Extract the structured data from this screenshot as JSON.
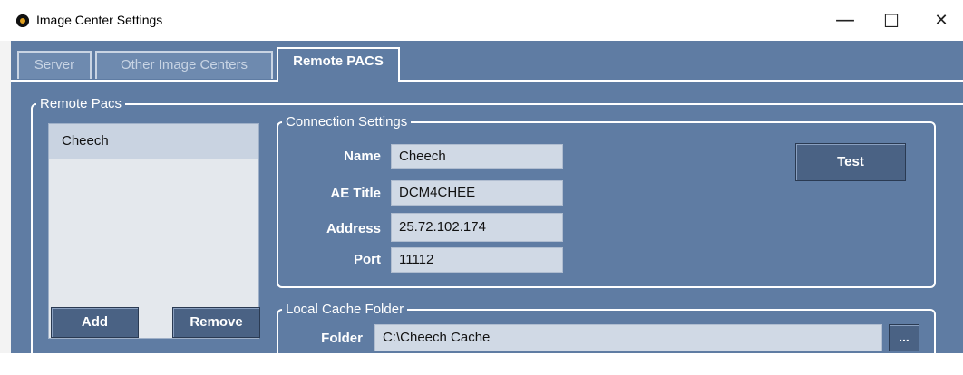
{
  "window": {
    "title": "Image Center Settings",
    "controls": {
      "minimize": "—",
      "maximize": "☐",
      "close": "✕"
    }
  },
  "tabs": [
    {
      "label": "Server",
      "active": false
    },
    {
      "label": "Other Image Centers",
      "active": false
    },
    {
      "label": "Remote PACS",
      "active": true
    }
  ],
  "remote_pacs": {
    "group_label": "Remote Pacs",
    "list": [
      "Cheech"
    ],
    "add_label": "Add",
    "remove_label": "Remove"
  },
  "connection": {
    "group_label": "Connection Settings",
    "name_label": "Name",
    "name_value": "Cheech",
    "ae_title_label": "AE Title",
    "ae_title_value": "DCM4CHEE",
    "address_label": "Address",
    "address_value": "25.72.102.174",
    "port_label": "Port",
    "port_value": "11112",
    "test_label": "Test"
  },
  "cache": {
    "group_label": "Local Cache Folder",
    "folder_label": "Folder",
    "folder_value": "C:\\Cheech Cache",
    "browse_label": "..."
  }
}
